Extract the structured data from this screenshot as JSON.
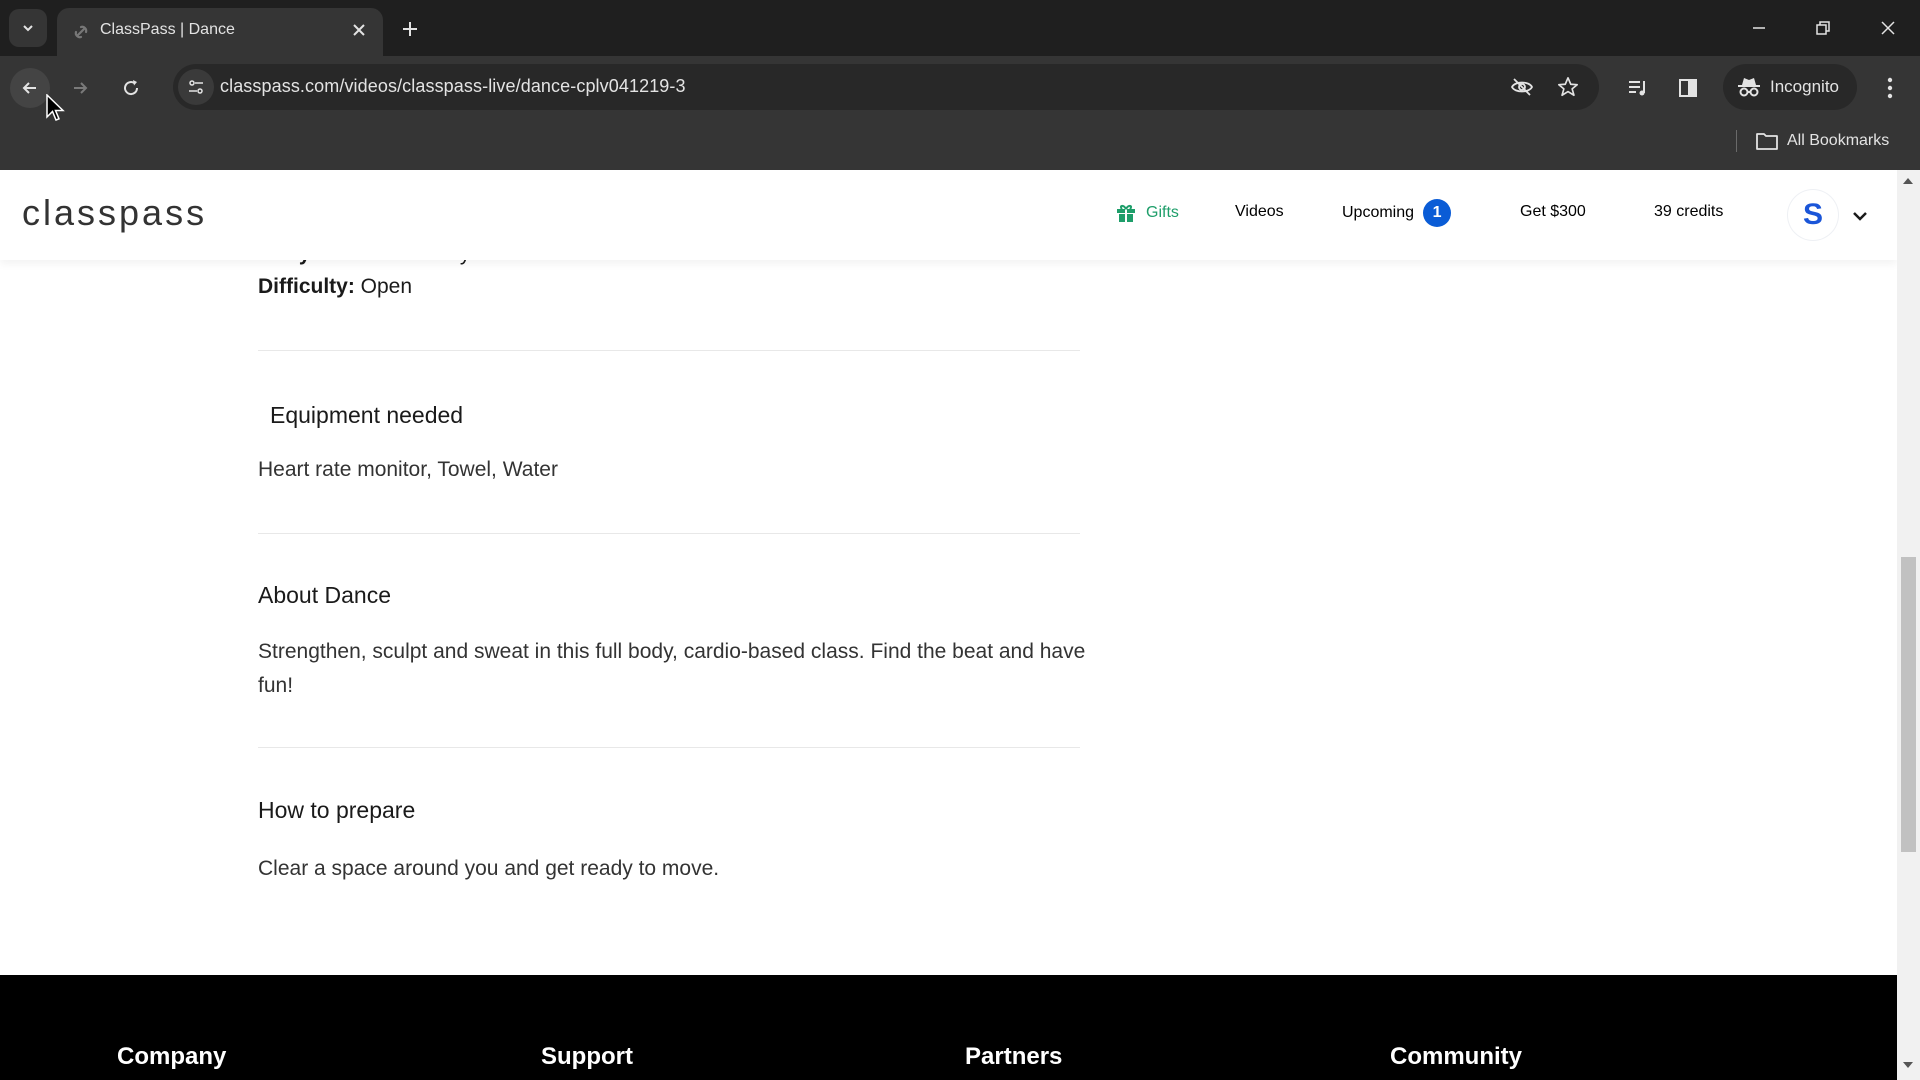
{
  "browser": {
    "tab": {
      "title": "ClassPass | Dance",
      "favicon": "link-icon"
    },
    "url": "classpass.com/videos/classpass-live/dance-cplv041219-3",
    "incognito_label": "Incognito",
    "bookmarks_label": "All Bookmarks",
    "icons": {
      "tab_search": "chevron-down-icon",
      "new_tab": "plus-icon",
      "back": "back-arrow-icon",
      "forward": "forward-arrow-icon",
      "reload": "reload-icon",
      "site_info": "tune-icon",
      "eye_off": "eye-slash-icon",
      "bookmark_star": "star-icon",
      "media": "media-queue-icon",
      "side_panel": "side-panel-icon",
      "menu": "kebab-menu-icon"
    }
  },
  "site": {
    "logo": "classpass",
    "nav": {
      "gifts": "Gifts",
      "videos": "Videos",
      "upcoming": "Upcoming",
      "upcoming_count": "1",
      "referral": "Get $300",
      "credits": "39 credits",
      "avatar_initial": "S"
    },
    "colors": {
      "gifts": "#1e9e6a",
      "badge": "#0a5cd6",
      "avatar": "#1a55d8"
    }
  },
  "details": {
    "body_focus_label": "Body focus:",
    "body_focus_value": "Full body",
    "difficulty_label": "Difficulty:",
    "difficulty_value": "Open"
  },
  "sections": [
    {
      "title": "Equipment needed",
      "body": "Heart rate monitor, Towel, Water"
    },
    {
      "title": "About Dance",
      "body": "Strengthen, sculpt and sweat in this full body, cardio-based class. Find the beat and have fun!"
    },
    {
      "title": "How to prepare",
      "body": "Clear a space around you and get ready to move."
    }
  ],
  "footer": {
    "columns": [
      "Company",
      "Support",
      "Partners",
      "Community"
    ]
  }
}
